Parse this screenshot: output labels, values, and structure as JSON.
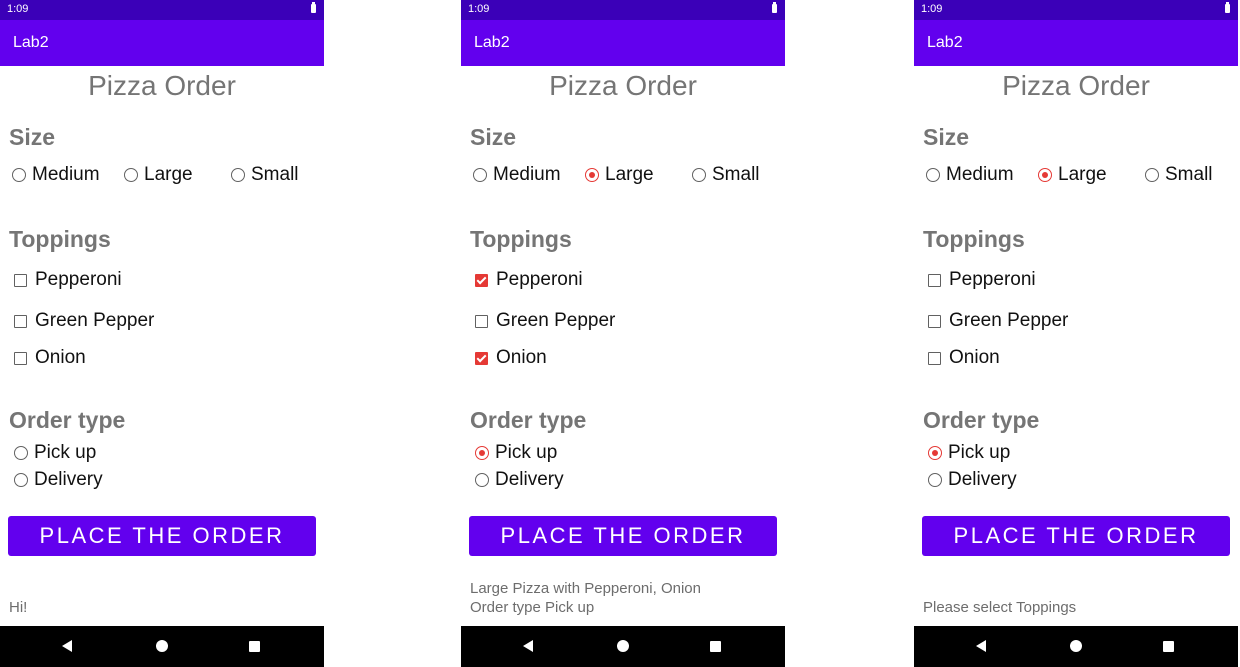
{
  "screens": [
    {
      "status_time": "1:09",
      "app_title": "Lab2",
      "page_title": "Pizza Order",
      "size_label": "Size",
      "sizes": [
        "Medium",
        "Large",
        "Small"
      ],
      "selected_size": null,
      "toppings_label": "Toppings",
      "toppings": [
        "Pepperoni",
        "Green Pepper",
        "Onion"
      ],
      "checked_toppings": [],
      "order_type_label": "Order type",
      "order_types": [
        "Pick up",
        "Delivery"
      ],
      "selected_order_type": null,
      "button_label": "PLACE THE ORDER",
      "result_line1": "",
      "result_line2": "Hi!"
    },
    {
      "status_time": "1:09",
      "app_title": "Lab2",
      "page_title": "Pizza Order",
      "size_label": "Size",
      "sizes": [
        "Medium",
        "Large",
        "Small"
      ],
      "selected_size": "Large",
      "toppings_label": "Toppings",
      "toppings": [
        "Pepperoni",
        "Green Pepper",
        "Onion"
      ],
      "checked_toppings": [
        "Pepperoni",
        "Onion"
      ],
      "order_type_label": "Order type",
      "order_types": [
        "Pick up",
        "Delivery"
      ],
      "selected_order_type": "Pick up",
      "button_label": "PLACE THE ORDER",
      "result_line1": "Large Pizza with Pepperoni, Onion",
      "result_line2": "Order type Pick up"
    },
    {
      "status_time": "1:09",
      "app_title": "Lab2",
      "page_title": "Pizza Order",
      "size_label": "Size",
      "sizes": [
        "Medium",
        "Large",
        "Small"
      ],
      "selected_size": "Large",
      "toppings_label": "Toppings",
      "toppings": [
        "Pepperoni",
        "Green Pepper",
        "Onion"
      ],
      "checked_toppings": [],
      "order_type_label": "Order type",
      "order_types": [
        "Pick up",
        "Delivery"
      ],
      "selected_order_type": "Pick up",
      "button_label": "PLACE THE ORDER",
      "result_line1": "",
      "result_line2": "Please select Toppings"
    }
  ],
  "colors": {
    "status_bar": "#3b00b8",
    "app_bar": "#6200ee",
    "button": "#6200ee",
    "accent": "#e53935"
  },
  "icons": {
    "nav_back": "back-triangle-icon",
    "nav_home": "home-circle-icon",
    "nav_recent": "recents-square-icon"
  }
}
